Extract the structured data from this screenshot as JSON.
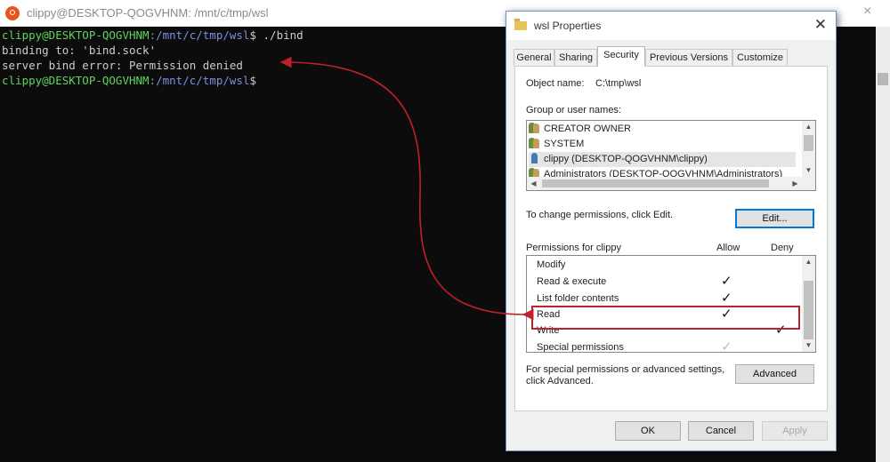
{
  "terminal": {
    "title": "clippy@DESKTOP-QOGVHNM: /mnt/c/tmp/wsl",
    "prompt_user": "clippy@DESKTOP-QOGVHNM",
    "prompt_path": ":/mnt/c/tmp/wsl",
    "prompt_symbol": "$",
    "command": " ./bind",
    "output_1": "binding to: 'bind.sock'",
    "output_2": "server bind error: Permission denied",
    "window_controls": {
      "minimize": "—",
      "close": "×"
    }
  },
  "dialog": {
    "title": "wsl Properties",
    "close": "✕",
    "tabs": [
      {
        "label": "General",
        "active": false
      },
      {
        "label": "Sharing",
        "active": false
      },
      {
        "label": "Security",
        "active": true
      },
      {
        "label": "Previous Versions",
        "active": false
      },
      {
        "label": "Customize",
        "active": false
      }
    ],
    "object_name_label": "Object name:",
    "object_name_value": "C:\\tmp\\wsl",
    "group_label": "Group or user names:",
    "users": [
      {
        "name": "CREATOR OWNER",
        "icon": "group-icon"
      },
      {
        "name": "SYSTEM",
        "icon": "group-icon"
      },
      {
        "name": "clippy (DESKTOP-QOGVHNM\\clippy)",
        "icon": "user-icon",
        "selected": true
      },
      {
        "name": "Administrators (DESKTOP-QOGVHNM\\Administrators)",
        "icon": "group-icon"
      }
    ],
    "change_perm_text": "To change permissions, click Edit.",
    "edit_button": "Edit...",
    "perm_for_label": "Permissions for clippy",
    "allow_header": "Allow",
    "deny_header": "Deny",
    "permissions": [
      {
        "name": "Modify",
        "allow": false,
        "deny": false
      },
      {
        "name": "Read & execute",
        "allow": true,
        "deny": false
      },
      {
        "name": "List folder contents",
        "allow": true,
        "deny": false
      },
      {
        "name": "Read",
        "allow": true,
        "deny": false
      },
      {
        "name": "Write",
        "allow": false,
        "deny": true
      },
      {
        "name": "Special permissions",
        "allow": "grey",
        "deny": false
      }
    ],
    "advanced_text_1": "For special permissions or advanced settings,",
    "advanced_text_2": "click Advanced.",
    "advanced_button": "Advanced",
    "ok_button": "OK",
    "cancel_button": "Cancel",
    "apply_button": "Apply"
  },
  "colors": {
    "terminal_bg": "#0c0c0c",
    "prompt_user": "#5fd35f",
    "prompt_path": "#7b8fe0",
    "annotation_red": "#c0202a"
  },
  "glyphs": {
    "check": "✓",
    "up": "▲",
    "down": "▼",
    "left": "◀",
    "right": "▶"
  }
}
